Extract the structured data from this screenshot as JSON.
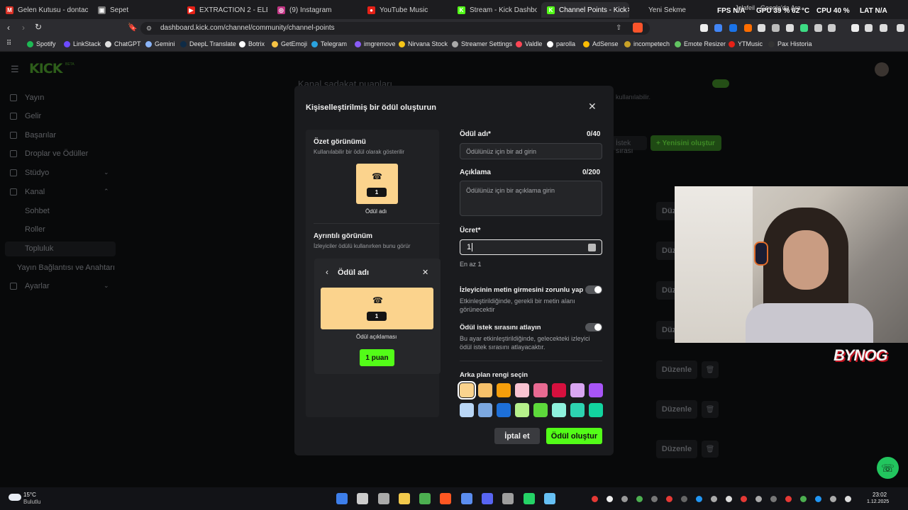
{
  "tabs": [
    {
      "label": "Gelen Kutusu - dontachist",
      "color": "#d93025",
      "glyph": "M"
    },
    {
      "label": "Sepet",
      "color": "#777",
      "glyph": "▣"
    },
    {
      "label": "EXTRACTION 2 - ELEŞTİRE",
      "color": "#e62117",
      "glyph": "▶"
    },
    {
      "label": "(9) Instagram",
      "color": "#c13584",
      "glyph": "◎"
    },
    {
      "label": "YouTube Music",
      "color": "#e62117",
      "glyph": "●"
    },
    {
      "label": "Stream - Kick Dashboard",
      "color": "#53fc18",
      "glyph": "K"
    },
    {
      "label": "Channel Points - Kick",
      "color": "#53fc18",
      "glyph": "K"
    },
    {
      "label": "Yeni Sekme",
      "color": "#555",
      "glyph": ""
    }
  ],
  "tab_overlay": "Jolafeil - Google'da Ara",
  "hud": {
    "fps": "FPS N/A",
    "gpu": "GPU 39 % 62 °C",
    "cpu": "CPU 40 %",
    "lat": "LAT N/A"
  },
  "url": "dashboard.kick.com/channel/community/channel-points",
  "bookmarks": [
    {
      "label": "Spotify",
      "color": "#1db954"
    },
    {
      "label": "LinkStack",
      "color": "#6d4aff"
    },
    {
      "label": "ChatGPT",
      "color": "#e0e0e0"
    },
    {
      "label": "Gemini",
      "color": "#8ab4f8"
    },
    {
      "label": "DeepL Translate",
      "color": "#0f2b46"
    },
    {
      "label": "Botrix",
      "color": "#ffffff"
    },
    {
      "label": "GetEmoji",
      "color": "#f6c344"
    },
    {
      "label": "Telegram",
      "color": "#2aa3df"
    },
    {
      "label": "imgremove",
      "color": "#8a5cf6"
    },
    {
      "label": "Nirvana Stock",
      "color": "#f5c518"
    },
    {
      "label": "Streamer Settings",
      "color": "#aaaaaa"
    },
    {
      "label": "Valdle",
      "color": "#ff4655"
    },
    {
      "label": "parolla",
      "color": "#ffffff"
    },
    {
      "label": "AdSense",
      "color": "#fbbc04"
    },
    {
      "label": "incompetech",
      "color": "#c9a227"
    },
    {
      "label": "Emote Resizer",
      "color": "#62c462"
    },
    {
      "label": "YTMusic",
      "color": "#e62117"
    },
    {
      "label": "Pax Historia",
      "color": "#333333"
    }
  ],
  "logo": "KICK",
  "logo_beta": "BETA",
  "sidebar": [
    {
      "label": "Yayın"
    },
    {
      "label": "Gelir"
    },
    {
      "label": "Başarılar"
    },
    {
      "label": "Droplar ve Ödüller"
    },
    {
      "label": "Stüdyo",
      "chevron": "⌄"
    },
    {
      "label": "Kanal",
      "chevron": "⌃"
    },
    {
      "label": "Sohbet"
    },
    {
      "label": "Roller"
    },
    {
      "label": "Topluluk"
    },
    {
      "label": "Yayın Bağlantısı ve Anahtarı"
    },
    {
      "label": "Ayarlar",
      "chevron": "⌄"
    }
  ],
  "bg": {
    "heading": "Kanal sadakat puanları",
    "sub_fragment": "kullanılabilir.",
    "queue_btn": "İstek sırası",
    "new_btn": "Yenisini oluştur",
    "edit": "Düzene",
    "edit_full": "Düzenle"
  },
  "modal": {
    "title": "Kişiselleştirilmiş bir ödül oluşturun",
    "summary_title": "Özet görünümü",
    "summary_sub": "Kullanılabilir bir ödül olarak gösterilir",
    "card_count": "1",
    "card_name": "Ödül adı",
    "detail_title": "Ayrıntılı görünüm",
    "detail_sub": "İzleyiciler ödülü kullanırken bunu görür",
    "detail_header": "Ödül adı",
    "detail_desc": "Ödül açıklaması",
    "points_btn": "1 puan",
    "name_label": "Ödül adı*",
    "name_count": "0/40",
    "name_placeholder": "Ödülünüz için bir ad girin",
    "desc_label": "Açıklama",
    "desc_count": "0/200",
    "desc_placeholder": "Ödülünüz için bir açıklama girin",
    "cost_label": "Ücret*",
    "cost_value": "1",
    "cost_hint": "En az 1",
    "toggle1_title": "İzleyicinin metin girmesini zorunlu yap",
    "toggle1_desc": "Etkinleştirildiğinde, gerekli bir metin alanı görünecektir",
    "toggle2_title": "Ödül istek sırasını atlayın",
    "toggle2_desc": "Bu ayar etkinleştirildiğinde, gelecekteki izleyici ödül istek sırasını atlayacaktır.",
    "color_label": "Arka plan rengi seçin",
    "colors": [
      "#fbd38d",
      "#f6c06a",
      "#f59e0b",
      "#f9c4d2",
      "#e86a92",
      "#d6103e",
      "#d9a6f2",
      "#a855f7",
      "#b9d6f5",
      "#7ca8e0",
      "#1d6fd8",
      "#b6f08b",
      "#5dd93b",
      "#8ef2dd",
      "#2dd4b1",
      "#12d49f"
    ],
    "cancel": "İptal et",
    "submit": "Ödül oluştur"
  },
  "overlay": {
    "watermark": "BYNOG"
  },
  "taskbar": {
    "temp": "15°C",
    "weather": "Bulutlu",
    "time": "23:02",
    "date": "1.12.2025"
  }
}
